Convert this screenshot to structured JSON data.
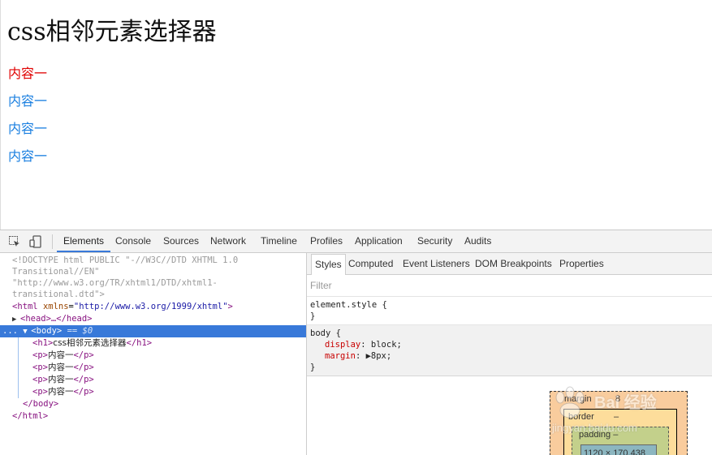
{
  "page": {
    "heading": "css相邻元素选择器",
    "paragraphs": [
      "内容一",
      "内容一",
      "内容一",
      "内容一"
    ],
    "colors": {
      "first_paragraph": "#e00000",
      "other_paragraphs": "#1a7fe0"
    }
  },
  "devtools": {
    "icons": {
      "inspect": "inspect-element-icon",
      "device": "device-toolbar-icon"
    },
    "tabs": [
      "Elements",
      "Console",
      "Sources",
      "Network",
      "Timeline",
      "Profiles",
      "Application",
      "Security",
      "Audits"
    ],
    "active_tab": "Elements",
    "dom": {
      "doctype_1": "<!DOCTYPE html PUBLIC \"-//W3C//DTD XHTML 1.0",
      "doctype_2": "Transitional//EN\"",
      "doctype_3": "\"http://www.w3.org/TR/xhtml1/DTD/xhtml1-",
      "doctype_4": "transitional.dtd\">",
      "html_open_tag": "<html",
      "html_attr_name": "xmlns",
      "html_attr_value": "\"http://www.w3.org/1999/xhtml\"",
      "html_open_end": ">",
      "head_collapsed": "<head>…</head>",
      "body_open": "<body>",
      "body_selected_marker": "== $0",
      "body_dots": "...",
      "h1_open": "<h1>",
      "h1_text": "css相邻元素选择器",
      "h1_close": "</h1>",
      "p_open": "<p>",
      "p_text": "内容一",
      "p_close": "</p>",
      "body_close": "</body>",
      "html_close": "</html>"
    },
    "styles": {
      "subtabs": [
        "Styles",
        "Computed",
        "Event Listeners",
        "DOM Breakpoints",
        "Properties"
      ],
      "active_subtab": "Styles",
      "filter_placeholder": "Filter",
      "rule1_selector": "element.style {",
      "rule1_close": "}",
      "rule2_selector": "body {",
      "rule2_prop1_name": "display",
      "rule2_prop1_value": ": block;",
      "rule2_prop2_name": "margin",
      "rule2_prop2_value": ": ▶8px;",
      "rule2_close": "}",
      "box_model": {
        "margin_label": "margin",
        "margin_value": "8",
        "border_label": "border",
        "border_value": "–",
        "padding_label": "padding –",
        "content_label": "1120 × 170.438"
      }
    }
  },
  "watermark": {
    "brand": "Bai 经验",
    "url": "jingyan.baidu.com"
  }
}
